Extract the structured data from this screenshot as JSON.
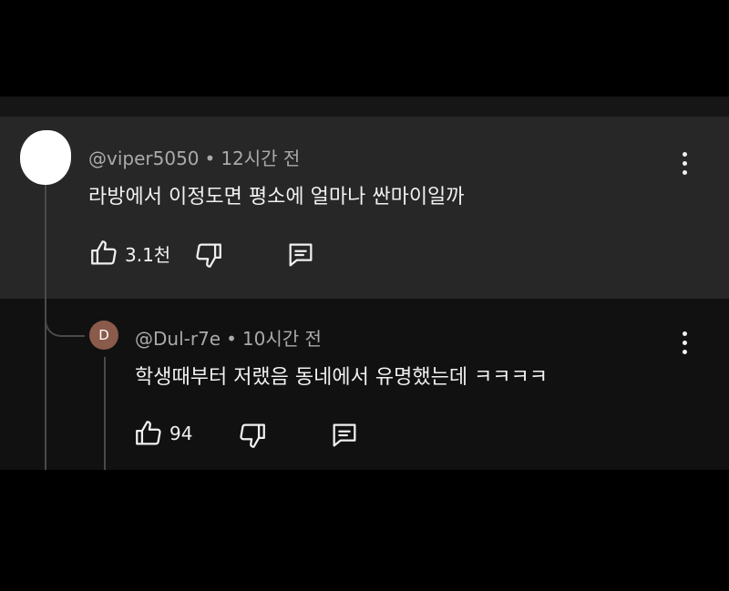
{
  "comments": [
    {
      "handle": "@viper5050",
      "time": "12시간 전",
      "text": "라방에서 이정도면 평소에 얼마나 싼마이일까",
      "likes": "3.1천",
      "avatar_initial": ""
    },
    {
      "handle": "@Dul-r7e",
      "time": "10시간 전",
      "text": "학생때부터 저랬음 동네에서 유명했는데 ㅋㅋㅋㅋ",
      "likes": "94",
      "avatar_initial": "D"
    }
  ],
  "separator": "•",
  "icons": [
    "thumbs-up-icon",
    "thumbs-down-icon",
    "reply-icon",
    "more-options-icon"
  ],
  "colors": {
    "main_comment_bg": "#272727",
    "reply_bg": "#111111",
    "meta_text": "#aaaaaa",
    "avatar_reply": "#8a5a4a"
  }
}
